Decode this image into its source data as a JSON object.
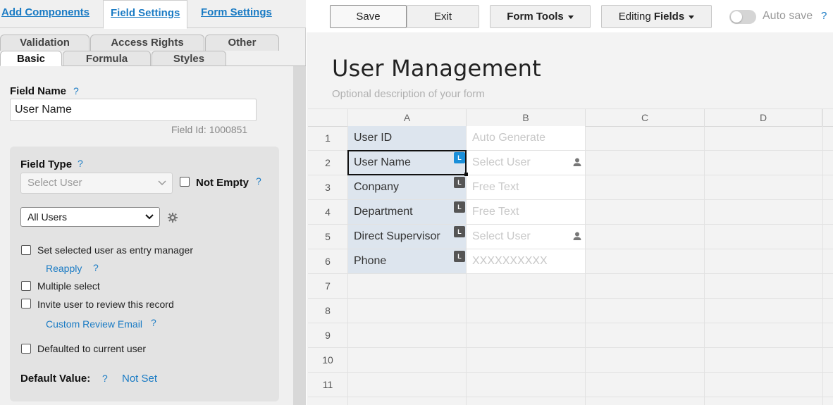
{
  "left_panel": {
    "top_nav": {
      "add_components": "Add Components",
      "field_settings": "Field Settings",
      "form_settings": "Form Settings"
    },
    "subtabs_row1": [
      "Validation",
      "Access Rights",
      "Other"
    ],
    "subtabs_row2": [
      "Basic",
      "Formula",
      "Styles"
    ],
    "active_subtab": "Basic",
    "field_name": {
      "label": "Field Name",
      "help": "?",
      "value": "User Name",
      "field_id_text": "Field Id: 1000851"
    },
    "field_type": {
      "label": "Field Type",
      "help": "?",
      "select_value": "Select User",
      "not_empty_label": "Not Empty",
      "not_empty_help": "?",
      "scope_value": "All Users",
      "options": [
        {
          "label": "Set selected user as entry manager",
          "checked": false
        },
        {
          "label": "Multiple select",
          "checked": false
        },
        {
          "label": "Invite user to review this record",
          "checked": false
        },
        {
          "label": "Defaulted to current user",
          "checked": false
        }
      ],
      "reapply_link": "Reapply",
      "reapply_help": "?",
      "custom_review_link": "Custom Review Email",
      "custom_review_help": "?",
      "default_value_label": "Default Value:",
      "default_value_help": "?",
      "default_value": "Not Set"
    }
  },
  "toolbar": {
    "save": "Save",
    "exit": "Exit",
    "form_tools": "Form Tools",
    "editing_prefix": "Editing ",
    "editing_bold": "Fields",
    "auto_save": "Auto save",
    "auto_save_on": false,
    "help": "?"
  },
  "form": {
    "title": "User Management",
    "description": "Optional description of your form"
  },
  "grid": {
    "columns": [
      "A",
      "B",
      "C",
      "D"
    ],
    "rows": [
      "1",
      "2",
      "3",
      "4",
      "5",
      "6",
      "7",
      "8",
      "9",
      "10",
      "11"
    ],
    "fields": [
      {
        "label": "User ID",
        "placeholder": "Auto Generate",
        "badge": "",
        "user_icon": false
      },
      {
        "label": "User Name",
        "placeholder": "Select User",
        "badge": "L",
        "user_icon": true,
        "selected": true
      },
      {
        "label": "Conpany",
        "placeholder": "Free Text",
        "badge": "L",
        "user_icon": false
      },
      {
        "label": "Department",
        "placeholder": "Free Text",
        "badge": "L",
        "user_icon": false
      },
      {
        "label": "Direct Supervisor",
        "placeholder": "Select User",
        "badge": "L",
        "user_icon": true
      },
      {
        "label": "Phone",
        "placeholder": "XXXXXXXXXX",
        "badge": "L",
        "user_icon": false
      }
    ]
  },
  "colors": {
    "link": "#1a7bc4",
    "field_cell": "#dde5ee",
    "badge": "#555555",
    "badge_selected": "#1a8fd9"
  }
}
